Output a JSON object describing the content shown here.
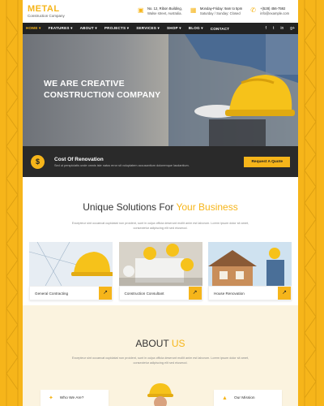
{
  "brand": {
    "name": "METAL",
    "tagline": "Construction Company",
    "accent": "#f6b51a",
    "dark": "#222222"
  },
  "header": {
    "address": {
      "icon": "briefcase-icon",
      "line1": "No. 12, Ribon Building,",
      "line2": "Walse street, Australia."
    },
    "hours": {
      "icon": "calendar-icon",
      "line1": "Monday-Friday: 9am to 5pm",
      "line2": "Saturday / Sunday: Closed"
    },
    "contact": {
      "icon": "phone-icon",
      "line1": "+(528) 456-7592",
      "line2": "info@example.com"
    }
  },
  "nav": {
    "items": [
      {
        "label": "HOME ▾",
        "active": true
      },
      {
        "label": "FEATURES ▾",
        "active": false
      },
      {
        "label": "ABOUT ▾",
        "active": false
      },
      {
        "label": "PROJECTS ▾",
        "active": false
      },
      {
        "label": "SERVICES ▾",
        "active": false
      },
      {
        "label": "SHOP ▾",
        "active": false
      },
      {
        "label": "BLOG ▾",
        "active": false
      },
      {
        "label": "CONTACT",
        "active": false
      }
    ],
    "social": [
      "f",
      "t",
      "in",
      "g+"
    ]
  },
  "hero": {
    "line1": "WE ARE CREATIVE",
    "line2": "CONSTRUCTION COMPANY"
  },
  "cost": {
    "icon_glyph": "$",
    "title": "Cost Of Renovation",
    "description": "Sed ut perspiciatis unde omnis iste natus error sit voluptatem accusantium doloremque laudantium.",
    "button": "Request A Quote"
  },
  "solutions": {
    "title_plain": "Unique Solutions For",
    "title_highlight": "Your Business",
    "description": "Excepteur sint occaecat cupidatat non proident, sunt in culpa officia deserunt mollit anim est laborum. Lorem ipsum dolor sit amet, consectetur adipiscing elit sed eiusmod.",
    "cards": [
      {
        "label": "General Contracting",
        "arrow": "↗"
      },
      {
        "label": "Construction Consultant",
        "arrow": "↗"
      },
      {
        "label": "House Renovation",
        "arrow": "↗"
      }
    ]
  },
  "about": {
    "title_plain": "ABOUT",
    "title_highlight": "US",
    "description": "Excepteur sint occaecat cupidatat non proident, sunt in culpa officia deserunt mollit anim est laborum. Lorem ipsum dolor sit amet, consectetur adipiscing elit sed eiusmod.",
    "who_label": "Who We Are?",
    "mission_label": "Our Mission"
  }
}
